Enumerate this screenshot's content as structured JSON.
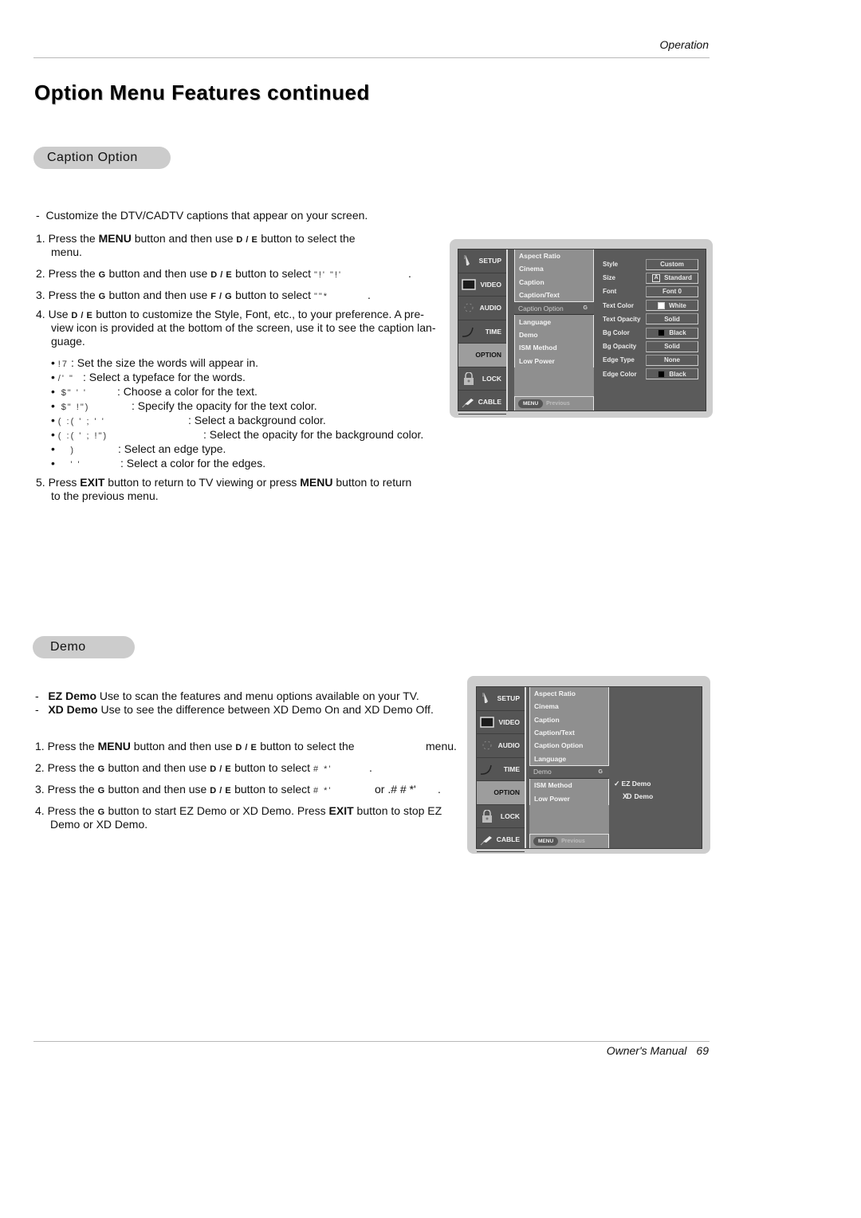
{
  "header": {
    "section": "Operation"
  },
  "page_title": "Option Menu Features continued",
  "caption_option": {
    "pill": "Caption Option",
    "intro": "Customize the DTV/CADTV captions that appear on your screen.",
    "steps": [
      {
        "num": "1.",
        "pre": "Press the ",
        "bold": "MENU",
        "mid": " button and then use ",
        "key1": "D",
        "sep": " / ",
        "key2": "E",
        "post": "  button to select the",
        "cont": "menu."
      },
      {
        "num": "2.",
        "pre": "Press the ",
        "key0": "G",
        "mid": "  button and then use ",
        "key1": "D",
        "sep": " / ",
        "key2": "E",
        "post": " button to select ",
        "garbled": "\"!'  \"!'",
        "end": "."
      },
      {
        "num": "3.",
        "pre": "Press the ",
        "key0": "G",
        "mid": "  button and then use ",
        "key1": "F",
        "sep": " / ",
        "key2": "G",
        "post": " button to select ",
        "garbled": "\"\"*",
        "end": "."
      },
      {
        "num": "4.",
        "pre": "Use ",
        "key1": "D",
        "sep": " / ",
        "key2": "E",
        "post": " button to customize the Style, Font, etc., to your preference. A pre-",
        "cont1": "view icon is provided at the bottom of the screen, use it to see the caption lan-",
        "cont2": "guage."
      }
    ],
    "bullets": [
      {
        "garbled": "!7",
        "desc": ": Set the size the words will appear in."
      },
      {
        "garbled": "/' \"",
        "desc": ": Select a typeface for the words."
      },
      {
        "garbled": "$\" ' '",
        "desc": ": Choose a color for the text."
      },
      {
        "garbled": "$\"    !\")",
        "desc": ": Specify the opacity for the text color."
      },
      {
        "garbled": "(  :(    '  ;  ' '",
        "desc": ": Select a background color."
      },
      {
        "garbled": "(  :(    '  ;    !\")",
        "desc": ": Select the opacity for the background color."
      },
      {
        "garbled": ")",
        "desc": ": Select an edge type."
      },
      {
        "garbled": "' '",
        "desc": ": Select a color for the edges."
      }
    ],
    "step5": {
      "num": "5.",
      "pre": "Press ",
      "b1": "EXIT",
      "mid": " button to return to TV viewing or press ",
      "b2": "MENU",
      "post": " button to return",
      "cont": "to the previous menu."
    }
  },
  "osd_common": {
    "tabs": [
      "SETUP",
      "VIDEO",
      "AUDIO",
      "TIME",
      "OPTION",
      "LOCK",
      "CABLE"
    ],
    "active_tab": "OPTION",
    "submenu": [
      "Aspect Ratio",
      "Cinema",
      "Caption",
      "Caption/Text",
      "Caption Option",
      "Language",
      "Demo",
      "ISM Method",
      "Low Power"
    ],
    "arrow_key": "G",
    "footer_button": "MENU",
    "footer_label": "Previous"
  },
  "osd_caption": {
    "selected_item": "Caption Option",
    "options": [
      {
        "label": "Style",
        "value": "Custom",
        "swatch": ""
      },
      {
        "label": "Size",
        "value": "Standard",
        "swatch": "A"
      },
      {
        "label": "Font",
        "value": "Font  0",
        "swatch": ""
      },
      {
        "label": "Text Color",
        "value": "White",
        "swatch": "white"
      },
      {
        "label": "Text Opacity",
        "value": "Solid",
        "swatch": ""
      },
      {
        "label": "Bg Color",
        "value": "Black",
        "swatch": "black"
      },
      {
        "label": "Bg Opacity",
        "value": "Solid",
        "swatch": ""
      },
      {
        "label": "Edge Type",
        "value": "None",
        "swatch": ""
      },
      {
        "label": "Edge Color",
        "value": "Black",
        "swatch": "black"
      }
    ]
  },
  "demo": {
    "pill": "Demo",
    "defs": [
      {
        "term": "EZ Demo",
        "desc": "  Use to scan the features and menu options available on your TV."
      },
      {
        "term": "XD Demo",
        "desc": "  Use to see the difference between XD Demo On and XD Demo Off."
      }
    ],
    "steps": [
      {
        "num": "1.",
        "pre": "Press the ",
        "bold": "MENU",
        "mid": " button and then use ",
        "key1": "D",
        "sep": " / ",
        "key2": "E",
        "post": "  button to select the",
        "end": "menu."
      },
      {
        "num": "2.",
        "pre": "Press the ",
        "key0": "G",
        "mid": "  button and then use ",
        "key1": "D",
        "sep": " / ",
        "key2": "E",
        "post": "  button to select ",
        "garbled": "# *'",
        "end": "."
      },
      {
        "num": "3.",
        "pre": "Press the ",
        "key0": "G",
        "mid": "  button and then use ",
        "key1": "D",
        "sep": " / ",
        "key2": "E",
        "post": "  button to select  ",
        "garbled": "# *'",
        "or": "or .# # *'",
        "end": "."
      },
      {
        "num": "4.",
        "pre": "Press the ",
        "key0": "G",
        "mid": "  button to start EZ Demo or XD Demo. Press ",
        "b1": "EXIT",
        "post": " button to stop EZ",
        "cont": "Demo or XD Demo."
      }
    ],
    "osd": {
      "selected_item": "Demo",
      "options": [
        {
          "label": "EZ Demo",
          "checked": true,
          "check_glyph": "✓"
        },
        {
          "label": "Demo",
          "logo": "XD",
          "checked": false
        }
      ]
    }
  },
  "footer": {
    "label": "Owner's Manual",
    "page": "69"
  }
}
